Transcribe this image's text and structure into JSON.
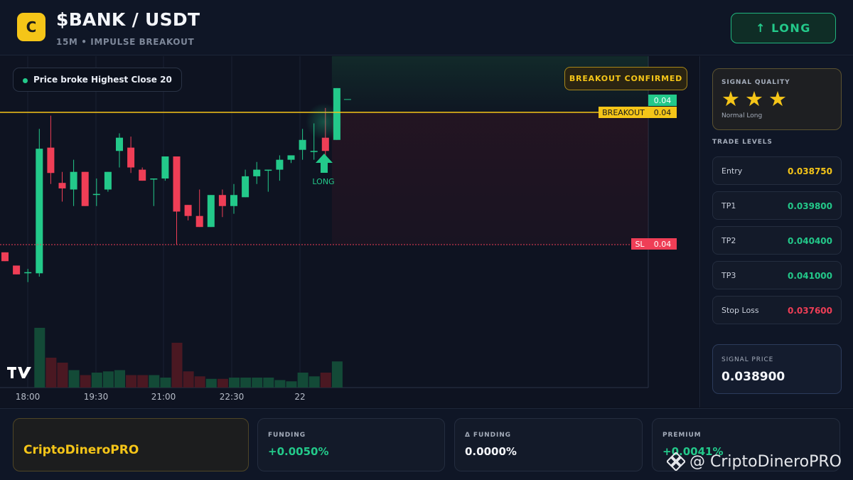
{
  "header": {
    "logo_letter": "C",
    "title": "$BANK / USDT",
    "subtitle": "15M • IMPULSE BREAKOUT",
    "direction_button": "↑ LONG"
  },
  "chart": {
    "note": "Price broke Highest Close 20",
    "badge": "BREAKOUT CONFIRMED",
    "last_price_tag": "0.04",
    "breakout_label": "BREAKOUT",
    "breakout_value": "0.04",
    "sl_label": "SL",
    "sl_value": "0.04",
    "signal_label": "LONG",
    "time_labels": [
      "18:00",
      "19:30",
      "21:00",
      "22:30",
      "22"
    ]
  },
  "chart_data": {
    "type": "candlestick",
    "breakout_level": 0.0388,
    "stop_loss_level": 0.0376,
    "candles": [
      {
        "o": 0.03753,
        "h": 0.03753,
        "l": 0.03745,
        "c": 0.03745
      },
      {
        "o": 0.03741,
        "h": 0.03741,
        "l": 0.03733,
        "c": 0.03733
      },
      {
        "o": 0.03735,
        "h": 0.03738,
        "l": 0.03726,
        "c": 0.03735
      },
      {
        "o": 0.03734,
        "h": 0.03865,
        "l": 0.03731,
        "c": 0.03847
      },
      {
        "o": 0.03848,
        "h": 0.03877,
        "l": 0.03815,
        "c": 0.03825
      },
      {
        "o": 0.03816,
        "h": 0.03826,
        "l": 0.03799,
        "c": 0.03811
      },
      {
        "o": 0.0381,
        "h": 0.03837,
        "l": 0.03795,
        "c": 0.03826
      },
      {
        "o": 0.03826,
        "h": 0.03826,
        "l": 0.03795,
        "c": 0.03795
      },
      {
        "o": 0.03806,
        "h": 0.0382,
        "l": 0.03795,
        "c": 0.03806
      },
      {
        "o": 0.0381,
        "h": 0.03826,
        "l": 0.03808,
        "c": 0.03826
      },
      {
        "o": 0.03845,
        "h": 0.03861,
        "l": 0.0383,
        "c": 0.03857
      },
      {
        "o": 0.03848,
        "h": 0.03858,
        "l": 0.03825,
        "c": 0.0383
      },
      {
        "o": 0.03828,
        "h": 0.0383,
        "l": 0.03818,
        "c": 0.03818
      },
      {
        "o": 0.0382,
        "h": 0.0382,
        "l": 0.03795,
        "c": 0.0382
      },
      {
        "o": 0.0382,
        "h": 0.0384,
        "l": 0.03818,
        "c": 0.0384
      },
      {
        "o": 0.0384,
        "h": 0.0384,
        "l": 0.0376,
        "c": 0.0379
      },
      {
        "o": 0.03796,
        "h": 0.03796,
        "l": 0.03782,
        "c": 0.03786
      },
      {
        "o": 0.03786,
        "h": 0.0381,
        "l": 0.03776,
        "c": 0.03776
      },
      {
        "o": 0.03776,
        "h": 0.03805,
        "l": 0.03776,
        "c": 0.03805
      },
      {
        "o": 0.03805,
        "h": 0.0381,
        "l": 0.03785,
        "c": 0.03795
      },
      {
        "o": 0.03795,
        "h": 0.03815,
        "l": 0.03788,
        "c": 0.03805
      },
      {
        "o": 0.03803,
        "h": 0.03828,
        "l": 0.03803,
        "c": 0.03822
      },
      {
        "o": 0.03822,
        "h": 0.03835,
        "l": 0.03815,
        "c": 0.03828
      },
      {
        "o": 0.03828,
        "h": 0.03828,
        "l": 0.03808,
        "c": 0.03828
      },
      {
        "o": 0.03828,
        "h": 0.03841,
        "l": 0.03818,
        "c": 0.03837
      },
      {
        "o": 0.03837,
        "h": 0.03841,
        "l": 0.03834,
        "c": 0.03841
      },
      {
        "o": 0.03846,
        "h": 0.03865,
        "l": 0.03837,
        "c": 0.03855
      },
      {
        "o": 0.03845,
        "h": 0.0387,
        "l": 0.03837,
        "c": 0.03845
      },
      {
        "o": 0.03857,
        "h": 0.03884,
        "l": 0.03837,
        "c": 0.03845
      },
      {
        "o": 0.03855,
        "h": 0.03902,
        "l": 0.03855,
        "c": 0.03902
      }
    ],
    "volumes": [
      0,
      0,
      0,
      48,
      24,
      20,
      14,
      10,
      12,
      13,
      14,
      10,
      10,
      10,
      8,
      36,
      13,
      9,
      7,
      7,
      8,
      8,
      8,
      8,
      6,
      5,
      12,
      9,
      12,
      21
    ]
  },
  "signal_quality": {
    "title": "SIGNAL QUALITY",
    "stars": 3,
    "label": "Normal Long"
  },
  "trade_levels": {
    "title": "TRADE LEVELS",
    "items": [
      {
        "label": "Entry",
        "value": "0.038750",
        "color": "#f5c518"
      },
      {
        "label": "TP1",
        "value": "0.039800",
        "color": "#23c98a"
      },
      {
        "label": "TP2",
        "value": "0.040400",
        "color": "#23c98a"
      },
      {
        "label": "TP3",
        "value": "0.041000",
        "color": "#23c98a"
      },
      {
        "label": "Stop Loss",
        "value": "0.037600",
        "color": "#ef3e56"
      }
    ]
  },
  "signal_price": {
    "label": "SIGNAL PRICE",
    "value": "0.038900"
  },
  "footer": {
    "brand": "CriptoDineroPRO",
    "funding_label": "FUNDING",
    "funding_value": "+0.0050%",
    "dfunding_label": "Δ FUNDING",
    "dfunding_value": "0.0000%",
    "premium_label": "PREMIUM",
    "premium_value": "+0.0041%",
    "watermark": "@ CriptoDineroPRO"
  },
  "colors": {
    "up": "#23c98a",
    "down": "#ef3e56",
    "accent": "#f5c518"
  }
}
